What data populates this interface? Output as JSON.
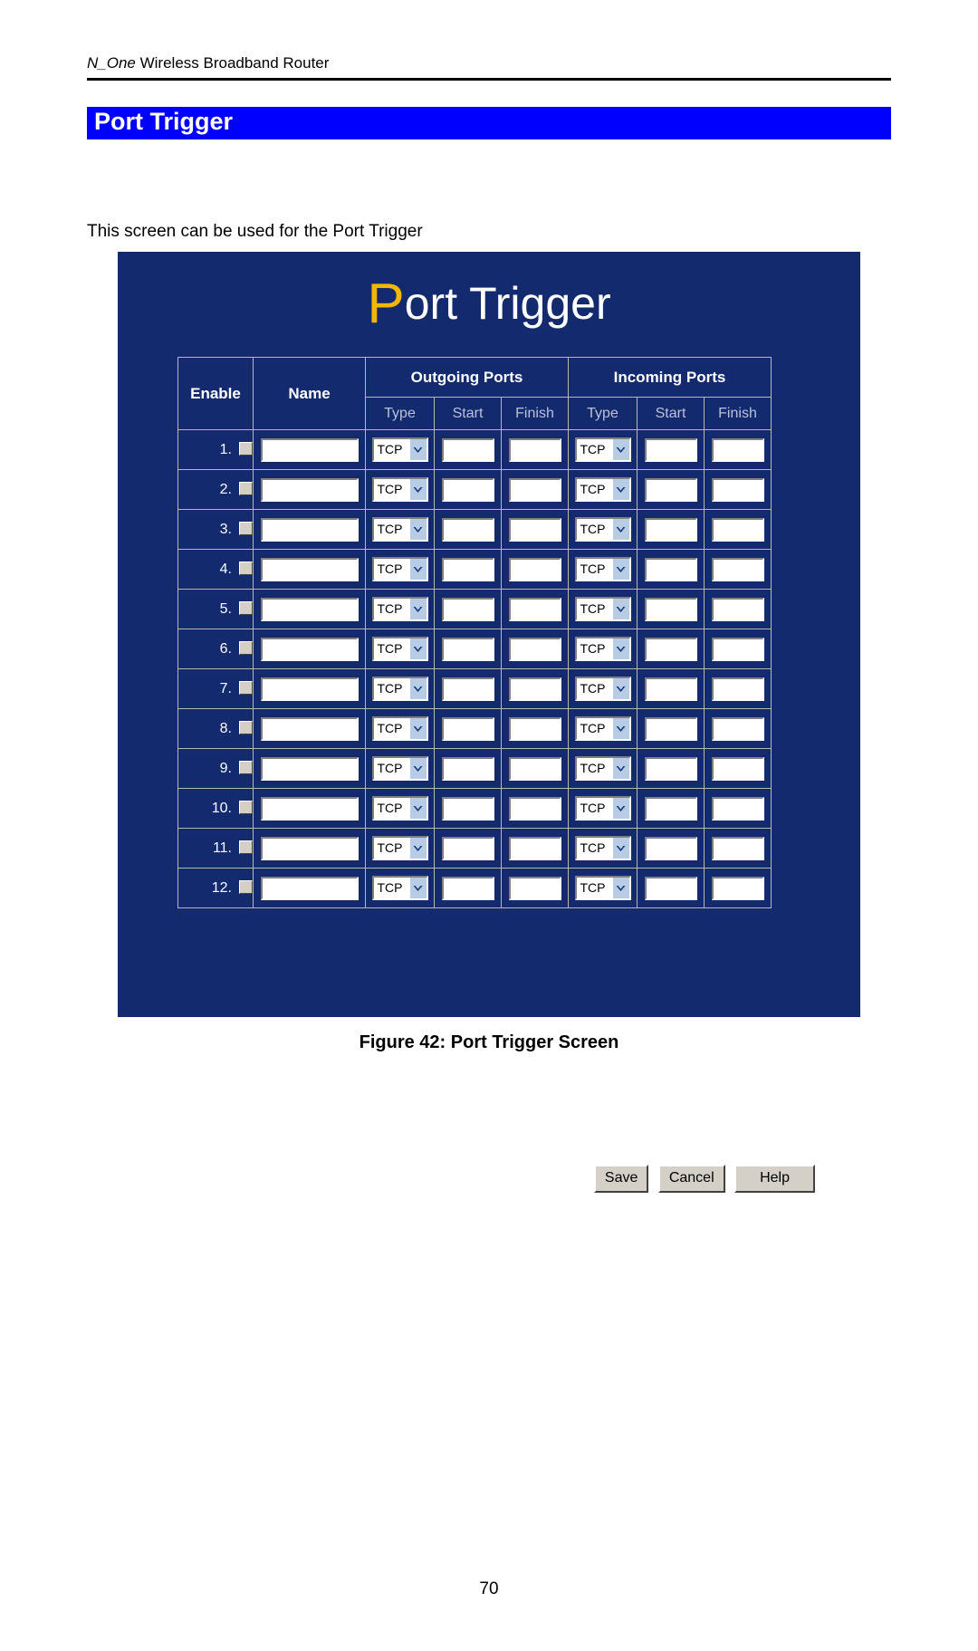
{
  "document": {
    "running_head_italic": "N_One",
    "running_head_rest": " Wireless Broadband Router",
    "chapter_title": "Port Trigger",
    "intro_text": "This screen can be used for the Port Trigger",
    "figure_caption": "Figure 42: Port Trigger Screen",
    "page_number": "70"
  },
  "colors": {
    "title_bar": "#0000FF",
    "screen_background": "#142A6E",
    "logo_accent": "#F2B705",
    "sub_header_text": "#B9C2D8",
    "dropdown_button": "#B8CCE4"
  },
  "screen": {
    "logo_first_letter": "P",
    "logo_rest": "ort Trigger",
    "table": {
      "group_headers": [
        {
          "label": "",
          "span": 2
        },
        {
          "label": "Outgoing Ports",
          "span": 3
        },
        {
          "label": "Incoming Ports",
          "span": 3
        }
      ],
      "column_headers": [
        "Enable",
        "Name",
        "Type",
        "Start",
        "Finish",
        "Type",
        "Start",
        "Finish"
      ],
      "rows": [
        {
          "index": "1.",
          "enabled": false,
          "name": "",
          "outgoing_type": "TCP",
          "outgoing_start": "",
          "outgoing_finish": "",
          "incoming_type": "TCP",
          "incoming_start": "",
          "incoming_finish": ""
        },
        {
          "index": "2.",
          "enabled": false,
          "name": "",
          "outgoing_type": "TCP",
          "outgoing_start": "",
          "outgoing_finish": "",
          "incoming_type": "TCP",
          "incoming_start": "",
          "incoming_finish": ""
        },
        {
          "index": "3.",
          "enabled": false,
          "name": "",
          "outgoing_type": "TCP",
          "outgoing_start": "",
          "outgoing_finish": "",
          "incoming_type": "TCP",
          "incoming_start": "",
          "incoming_finish": ""
        },
        {
          "index": "4.",
          "enabled": false,
          "name": "",
          "outgoing_type": "TCP",
          "outgoing_start": "",
          "outgoing_finish": "",
          "incoming_type": "TCP",
          "incoming_start": "",
          "incoming_finish": ""
        },
        {
          "index": "5.",
          "enabled": false,
          "name": "",
          "outgoing_type": "TCP",
          "outgoing_start": "",
          "outgoing_finish": "",
          "incoming_type": "TCP",
          "incoming_start": "",
          "incoming_finish": ""
        },
        {
          "index": "6.",
          "enabled": false,
          "name": "",
          "outgoing_type": "TCP",
          "outgoing_start": "",
          "outgoing_finish": "",
          "incoming_type": "TCP",
          "incoming_start": "",
          "incoming_finish": ""
        },
        {
          "index": "7.",
          "enabled": false,
          "name": "",
          "outgoing_type": "TCP",
          "outgoing_start": "",
          "outgoing_finish": "",
          "incoming_type": "TCP",
          "incoming_start": "",
          "incoming_finish": ""
        },
        {
          "index": "8.",
          "enabled": false,
          "name": "",
          "outgoing_type": "TCP",
          "outgoing_start": "",
          "outgoing_finish": "",
          "incoming_type": "TCP",
          "incoming_start": "",
          "incoming_finish": ""
        },
        {
          "index": "9.",
          "enabled": false,
          "name": "",
          "outgoing_type": "TCP",
          "outgoing_start": "",
          "outgoing_finish": "",
          "incoming_type": "TCP",
          "incoming_start": "",
          "incoming_finish": ""
        },
        {
          "index": "10.",
          "enabled": false,
          "name": "",
          "outgoing_type": "TCP",
          "outgoing_start": "",
          "outgoing_finish": "",
          "incoming_type": "TCP",
          "incoming_start": "",
          "incoming_finish": ""
        },
        {
          "index": "11.",
          "enabled": false,
          "name": "",
          "outgoing_type": "TCP",
          "outgoing_start": "",
          "outgoing_finish": "",
          "incoming_type": "TCP",
          "incoming_start": "",
          "incoming_finish": ""
        },
        {
          "index": "12.",
          "enabled": false,
          "name": "",
          "outgoing_type": "TCP",
          "outgoing_start": "",
          "outgoing_finish": "",
          "incoming_type": "TCP",
          "incoming_start": "",
          "incoming_finish": ""
        }
      ]
    },
    "buttons": {
      "save": "Save",
      "cancel": "Cancel",
      "help": "Help"
    }
  }
}
